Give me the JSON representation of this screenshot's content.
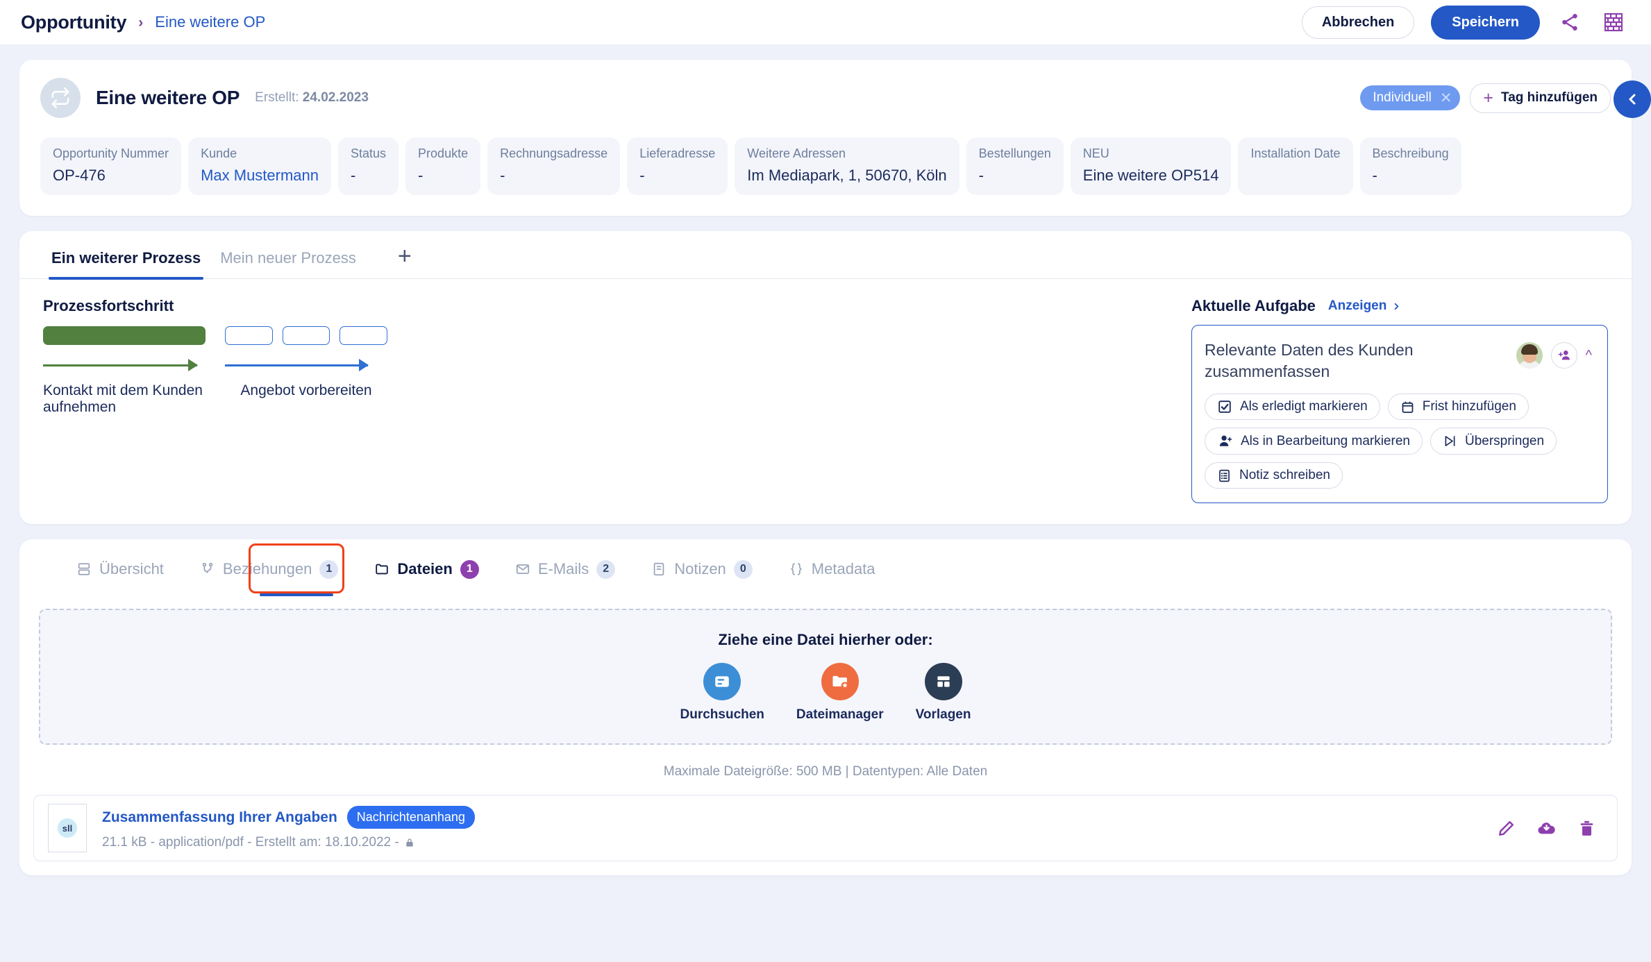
{
  "topbar": {
    "breadcrumb_root": "Opportunity",
    "breadcrumb_sep": "›",
    "breadcrumb_current": "Eine weitere OP",
    "cancel_label": "Abbrechen",
    "save_label": "Speichern",
    "share_icon": "share-icon",
    "wall_icon": "brick-wall-icon"
  },
  "summary": {
    "icon": "repeat-icon",
    "title": "Eine weitere OP",
    "created_label": "Erstellt:",
    "created_date": "24.02.2023",
    "tag": {
      "label": "Individuell",
      "remove_icon": "close-icon"
    },
    "add_tag_label": "Tag hinzufügen",
    "collapse_icon": "chevron-left-icon",
    "fields": [
      {
        "label": "Opportunity Nummer",
        "value": "OP-476",
        "style": "plain"
      },
      {
        "label": "Kunde",
        "value": "Max Mustermann",
        "style": "link"
      },
      {
        "label": "Status",
        "value": "-",
        "style": "plain"
      },
      {
        "label": "Produkte",
        "value": "-",
        "style": "plain"
      },
      {
        "label": "Rechnungsadresse",
        "value": "-",
        "style": "plain"
      },
      {
        "label": "Lieferadresse",
        "value": "-",
        "style": "plain"
      },
      {
        "label": "Weitere Adressen",
        "value": "Im Mediapark, 1, 50670, Köln",
        "style": "plain"
      },
      {
        "label": "Bestellungen",
        "value": "-",
        "style": "plain"
      },
      {
        "label": "NEU",
        "value": "Eine weitere OP514",
        "style": "plain"
      },
      {
        "label": "Installation Date",
        "value": "",
        "style": "plain"
      },
      {
        "label": "Beschreibung",
        "value": "-",
        "style": "plain"
      }
    ]
  },
  "process": {
    "tabs": [
      {
        "label": "Ein weiterer Prozess",
        "active": true
      },
      {
        "label": "Mein neuer Prozess",
        "active": false
      }
    ],
    "add_tab_icon": "plus-icon",
    "progress_heading": "Prozessfortschritt",
    "steps": [
      {
        "label": "Kontakt mit dem Kunden aufnehmen",
        "state": "done",
        "segments": 1,
        "color": "#51803f"
      },
      {
        "label": "Angebot vorbereiten",
        "state": "todo",
        "segments": 3,
        "color": "#2e6fd4"
      }
    ],
    "task": {
      "heading": "Aktuelle Aufgabe",
      "show_link": "Anzeigen",
      "show_link_icon": "chevron-right-icon",
      "name": "Relevante Daten des Kunden zusammenfassen",
      "avatar_icon": "user-avatar",
      "add_person_icon": "add-person-icon",
      "collapse_icon": "chevron-up-icon",
      "actions": [
        {
          "label": "Als erledigt markieren",
          "icon": "checkbox-icon"
        },
        {
          "label": "Frist hinzufügen",
          "icon": "calendar-icon"
        },
        {
          "label": "Als in Bearbeitung markieren",
          "icon": "person-add-icon"
        },
        {
          "label": "Überspringen",
          "icon": "skip-icon"
        },
        {
          "label": "Notiz schreiben",
          "icon": "note-icon"
        }
      ]
    }
  },
  "files_section": {
    "tabs": [
      {
        "label": "Übersicht",
        "icon": "overview-icon",
        "badge": null,
        "active": false
      },
      {
        "label": "Beziehungen",
        "icon": "relations-icon",
        "badge": "1",
        "active": false
      },
      {
        "label": "Dateien",
        "icon": "folder-icon",
        "badge": "1",
        "active": true
      },
      {
        "label": "E-Mails",
        "icon": "mail-icon",
        "badge": "2",
        "active": false
      },
      {
        "label": "Notizen",
        "icon": "note-icon",
        "badge": "0",
        "active": false
      },
      {
        "label": "Metadata",
        "icon": "braces-icon",
        "badge": null,
        "active": false
      }
    ],
    "highlight_color": "#f0401a",
    "dropzone": {
      "title": "Ziehe eine Datei hierher oder:",
      "options": [
        {
          "label": "Durchsuchen",
          "icon": "browse-icon",
          "color": "#3c8fd6"
        },
        {
          "label": "Dateimanager",
          "icon": "file-manager-icon",
          "color": "#ef6c41"
        },
        {
          "label": "Vorlagen",
          "icon": "templates-icon",
          "color": "#2c3e55"
        }
      ],
      "note": "Maximale Dateigröße: 500 MB  |  Datentypen: Alle Daten"
    },
    "file": {
      "thumb_text": "sll",
      "name": "Zusammenfassung Ihrer Angaben",
      "chip": "Nachrichtenanhang",
      "meta": "21.1 kB  -  application/pdf  -  Erstellt am: 18.10.2022  -",
      "lock_icon": "lock-icon",
      "actions": [
        {
          "icon": "edit-icon"
        },
        {
          "icon": "download-cloud-icon"
        },
        {
          "icon": "trash-icon"
        }
      ]
    }
  },
  "colors": {
    "accent_blue": "#2358c6",
    "purple": "#8e4bab",
    "green": "#51803f",
    "orange_highlight": "#f0401a",
    "badge_purple": "#8e3fae"
  }
}
